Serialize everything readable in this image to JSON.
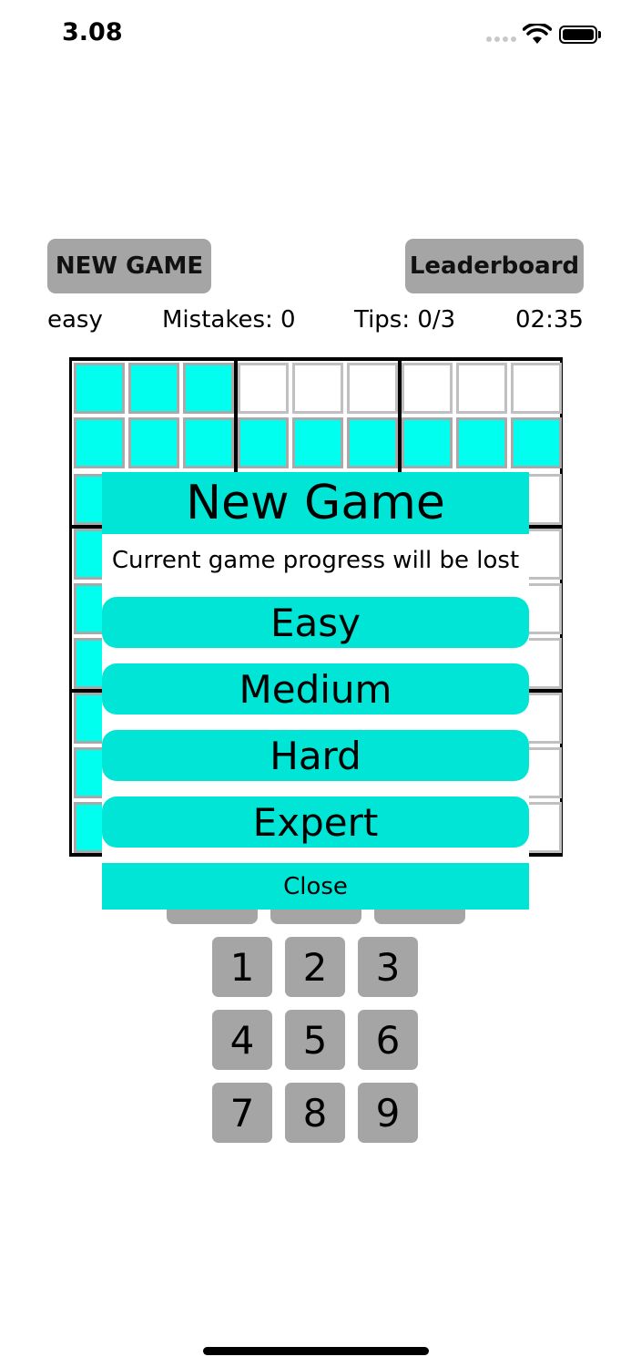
{
  "status_bar": {
    "time": "3.08",
    "signal_icon": "signal-dots-icon",
    "wifi_icon": "wifi-icon",
    "battery_icon": "battery-icon",
    "battery_level": 1.0
  },
  "header": {
    "new_game_label": "NEW GAME",
    "leaderboard_label": "Leaderboard"
  },
  "info": {
    "difficulty": "easy",
    "mistakes": "Mistakes: 0",
    "tips": "Tips: 0/3",
    "timer": "02:35"
  },
  "board": {
    "cell_color": "#00ffee",
    "grid_color": "#000000"
  },
  "keypad": {
    "keys": [
      "1",
      "2",
      "3",
      "4",
      "5",
      "6",
      "7",
      "8",
      "9"
    ]
  },
  "modal": {
    "title": "New Game",
    "message": "Current game progress will be lost",
    "options": [
      "Easy",
      "Medium",
      "Hard",
      "Expert"
    ],
    "close_label": "Close",
    "accent_color": "#00e5d6"
  }
}
